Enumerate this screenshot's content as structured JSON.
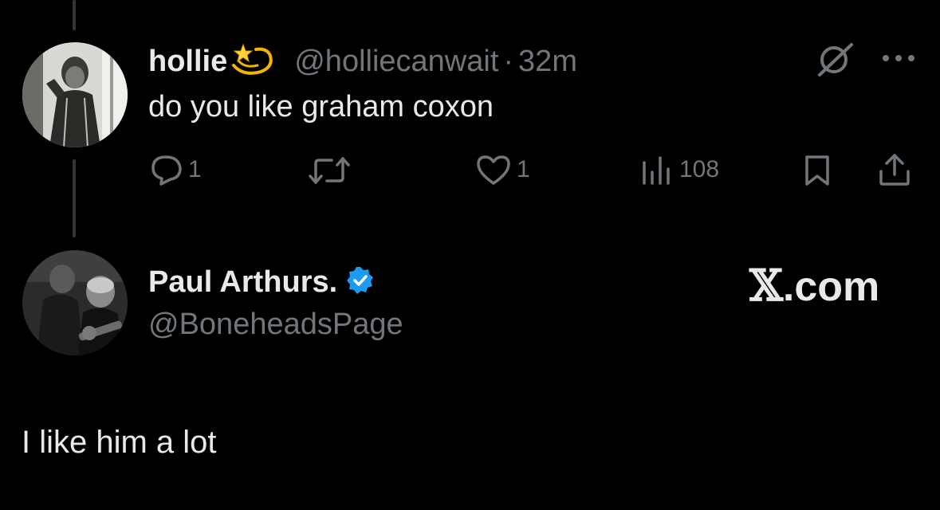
{
  "tweet": {
    "display_name": "hollie",
    "name_emoji": "dizzy-icon",
    "handle": "@holliecanwait",
    "separator": "·",
    "time": "32m",
    "text": "do you like graham coxon",
    "actions": {
      "reply_count": "1",
      "retweet_count": "",
      "like_count": "1",
      "views_count": "108"
    }
  },
  "reply": {
    "display_name": "Paul Arthurs.",
    "verified": true,
    "handle": "@BoneheadsPage",
    "text": "I like him a lot"
  },
  "watermark": {
    "x_symbol": "𝕏",
    "suffix": ".com"
  },
  "colors": {
    "background": "#000000",
    "primary_text": "#e7e9ea",
    "secondary_text": "#71767b",
    "verified_badge": "#1d9bf0",
    "thread_line": "#333639"
  }
}
